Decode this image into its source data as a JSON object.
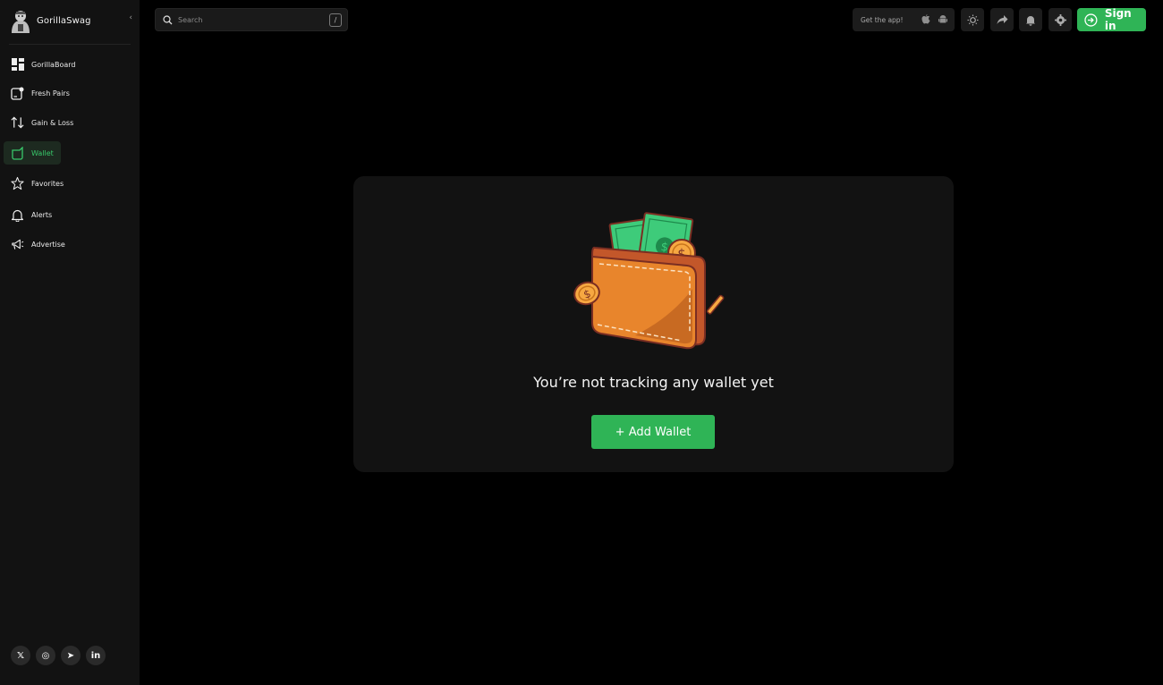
{
  "app": {
    "name": "GorillaSwag"
  },
  "sidebar": {
    "items": [
      {
        "label": "GorillaBoard",
        "icon": "dashboard-icon",
        "active": false
      },
      {
        "label": "Fresh Pairs",
        "icon": "fresh-pairs-icon",
        "active": false
      },
      {
        "label": "Gain & Loss",
        "icon": "arrows-updown-icon",
        "active": false
      },
      {
        "label": "Wallet",
        "icon": "wallet-icon",
        "active": true
      },
      {
        "label": "Favorites",
        "icon": "star-icon",
        "active": false
      },
      {
        "label": "Alerts",
        "icon": "bell-icon",
        "active": false
      },
      {
        "label": "Advertise",
        "icon": "megaphone-icon",
        "active": false
      }
    ],
    "socials": [
      {
        "name": "x-icon",
        "glyph": "𝕏"
      },
      {
        "name": "instagram-icon",
        "glyph": "◎"
      },
      {
        "name": "telegram-icon",
        "glyph": "➤"
      },
      {
        "name": "linkedin-icon",
        "glyph": "in"
      }
    ]
  },
  "search": {
    "placeholder": "Search",
    "shortcut": "/"
  },
  "topbar": {
    "get_app_label": "Get the app!",
    "sign_in_label": "Sign in"
  },
  "main": {
    "empty_title": "You’re not tracking any wallet yet",
    "add_wallet_label": "+ Add Wallet"
  },
  "colors": {
    "accent": "#2fb456",
    "background": "#000000",
    "panel": "#121212",
    "wallet_orange": "#e8852c",
    "money_green": "#3ecb7a",
    "coin_gold": "#f7a842"
  }
}
